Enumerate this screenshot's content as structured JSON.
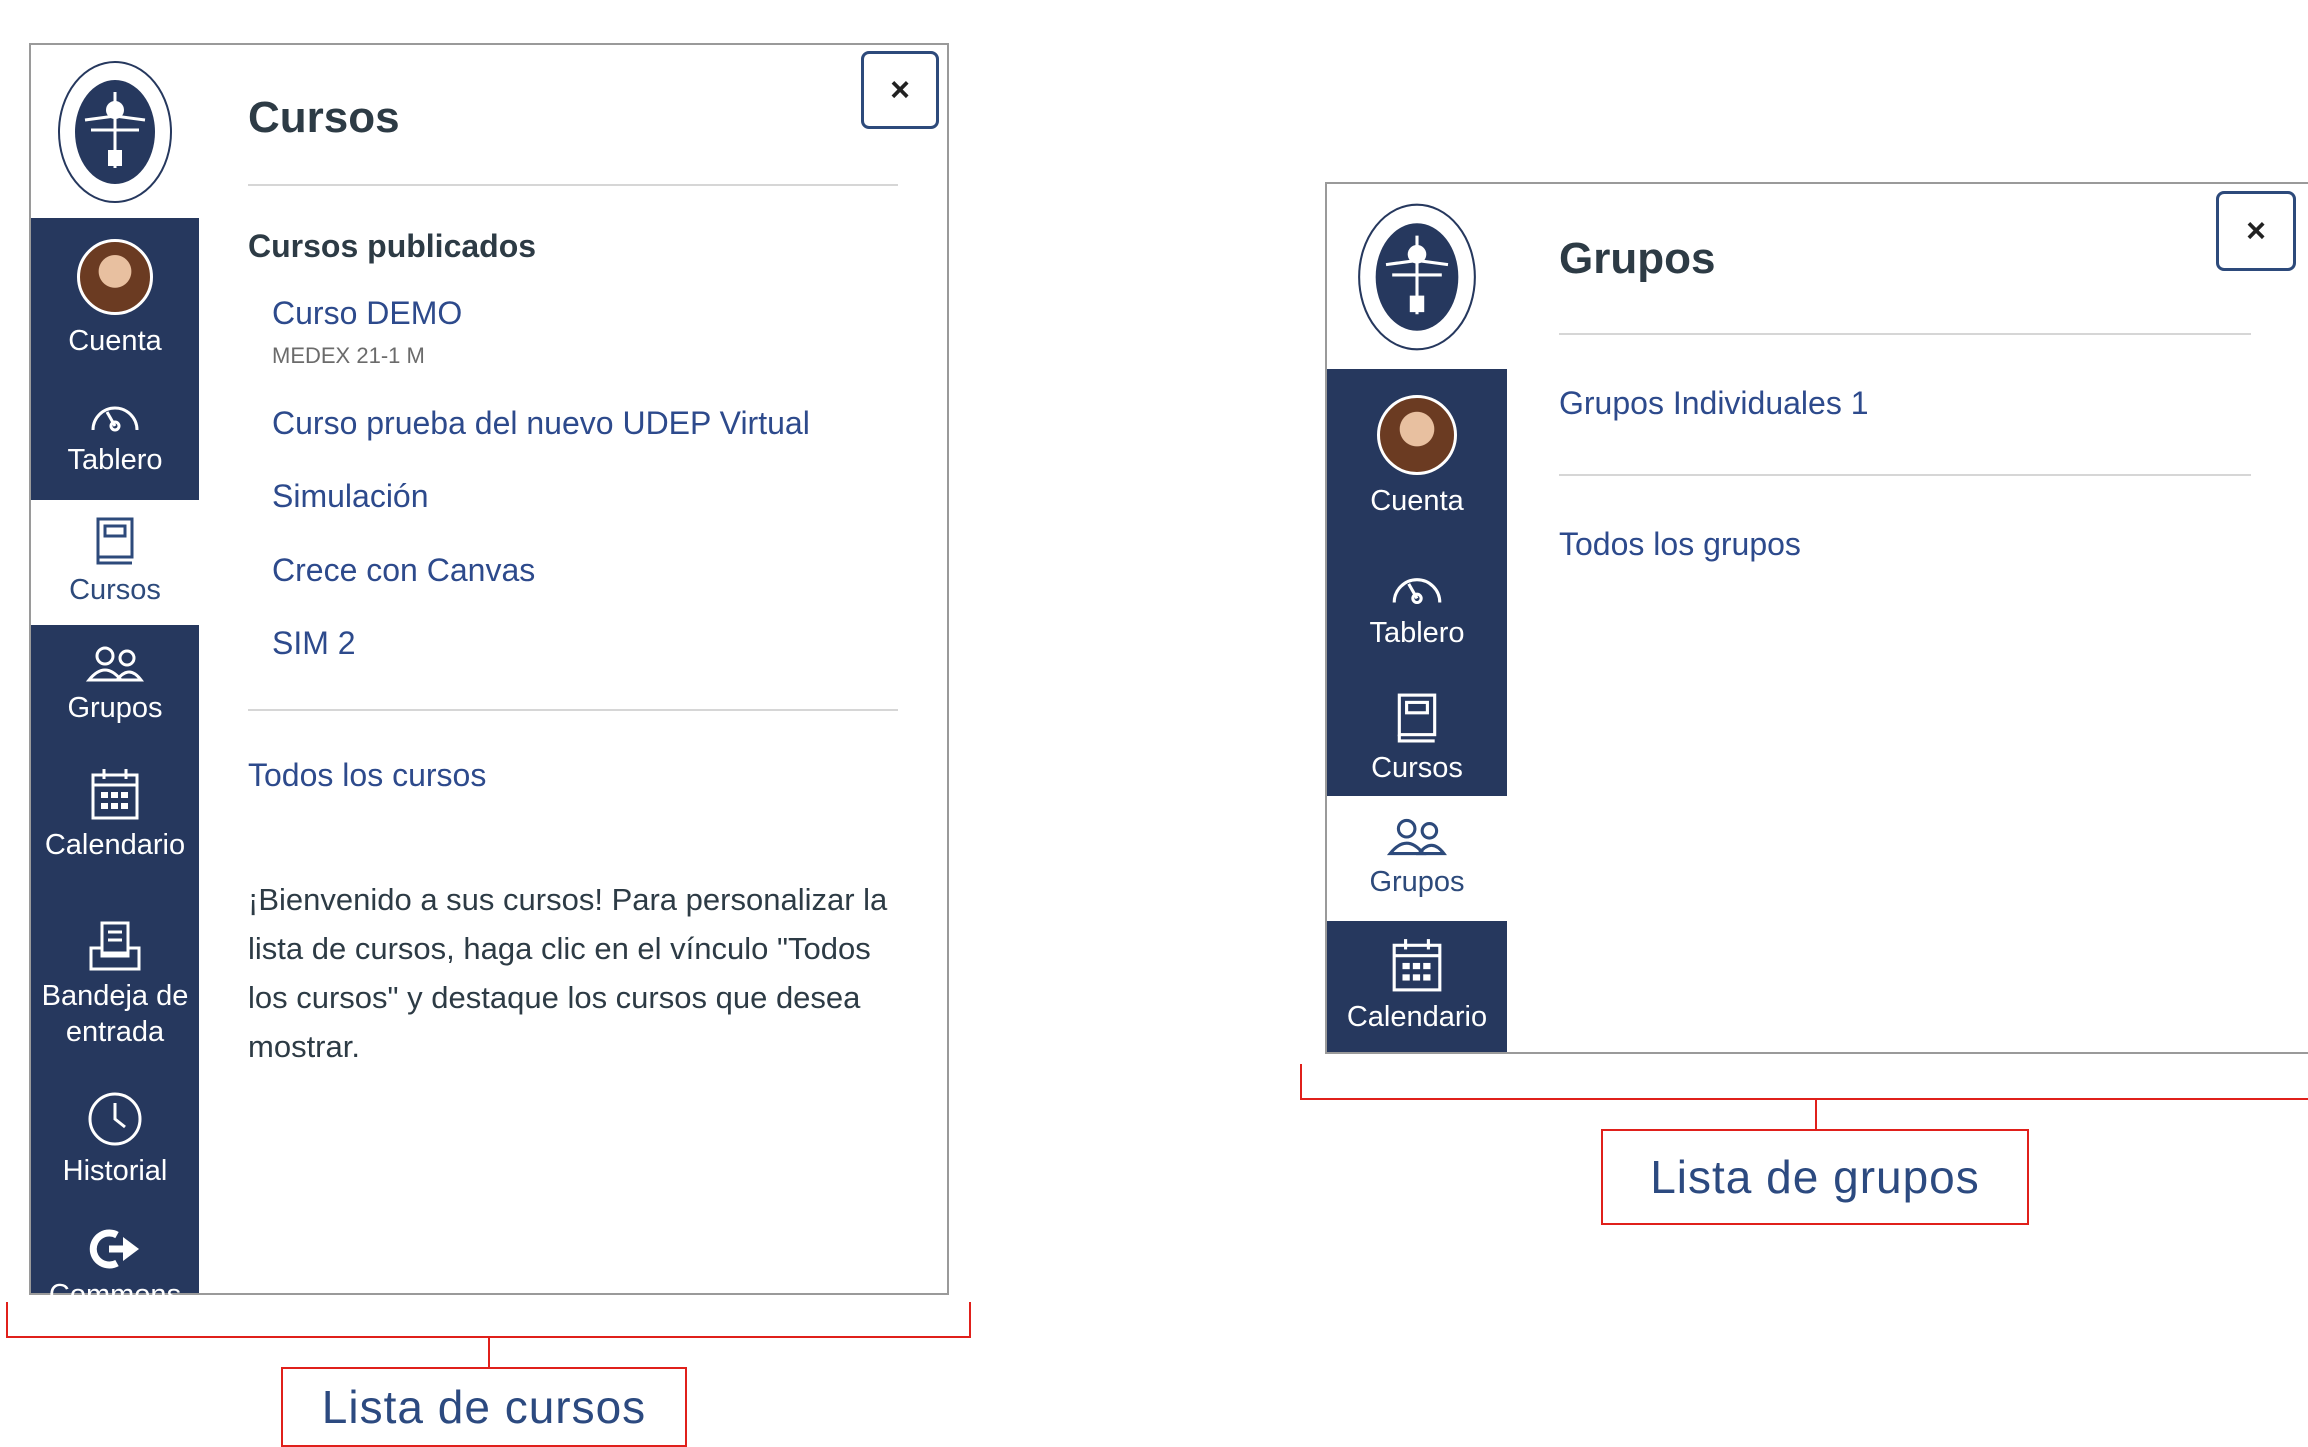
{
  "courses_panel": {
    "nav": {
      "account": "Cuenta",
      "dashboard": "Tablero",
      "courses": "Cursos",
      "groups": "Grupos",
      "calendar": "Calendario",
      "inbox_line1": "Bandeja de",
      "inbox_line2": "entrada",
      "history": "Historial",
      "commons": "Commons"
    },
    "close_label": "×",
    "title": "Cursos",
    "section_heading": "Cursos publicados",
    "courses": [
      {
        "name": "Curso DEMO",
        "code": "MEDEX 21-1 M"
      },
      {
        "name": "Curso prueba del nuevo UDEP Virtual"
      },
      {
        "name": "Simulación"
      },
      {
        "name": "Crece con Canvas"
      },
      {
        "name": "SIM 2"
      }
    ],
    "all_link": "Todos los cursos",
    "welcome": "¡Bienvenido a sus cursos! Para personalizar la lista de cursos, haga clic en el vínculo \"Todos los cursos\" y destaque los cursos que desea mostrar.",
    "welcome_lines": [
      "¡Bienvenido a sus cursos! Para personalizar la",
      "lista de cursos, haga clic en el vínculo \"Todos",
      "los cursos\" y destaque los cursos que desea",
      "mostrar."
    ]
  },
  "groups_panel": {
    "nav": {
      "account": "Cuenta",
      "dashboard": "Tablero",
      "courses": "Cursos",
      "groups": "Grupos",
      "calendar": "Calendario"
    },
    "close_label": "×",
    "title": "Grupos",
    "groups": [
      "Grupos Individuales 1"
    ],
    "all_link": "Todos los grupos"
  },
  "captions": {
    "courses": "Lista de cursos",
    "groups": "Lista de grupos"
  },
  "colors": {
    "nav_background": "#26385e",
    "link": "#2d4a8c",
    "annotation": "#e0201b"
  },
  "icons": {
    "logo": "university-seal-icon",
    "dashboard": "speedometer-icon",
    "courses": "book-icon",
    "groups": "people-icon",
    "calendar": "calendar-icon",
    "inbox": "inbox-icon",
    "history": "clock-icon",
    "commons": "share-arrow-icon",
    "close": "close-icon"
  }
}
